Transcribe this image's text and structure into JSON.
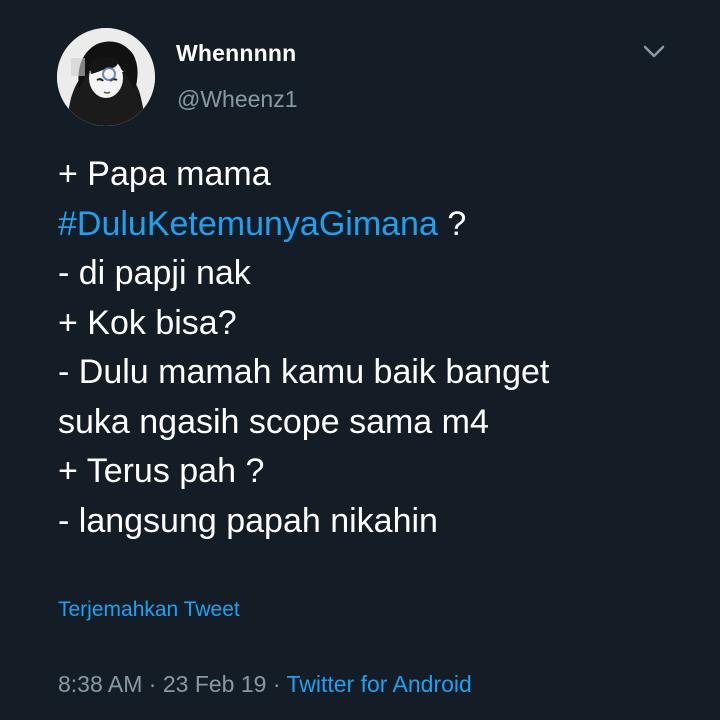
{
  "author": {
    "display_name": "Whennnnn",
    "handle": "@Wheenz1",
    "avatar": "anime-hooded-character-avatar"
  },
  "menu_icon": "chevron-down-icon",
  "tweet": {
    "line1": "+ Papa mama",
    "hashtag": "#DuluKetemunyaGimana",
    "line2_rest": " ?",
    "line3": "- di papji nak",
    "line4": "+ Kok bisa?",
    "line5": "- Dulu mamah kamu baik banget",
    "line6": "suka ngasih scope sama m4",
    "line7": "+ Terus pah ?",
    "line8": "- langsung papah nikahin"
  },
  "translate_label": "Terjemahkan Tweet",
  "meta": {
    "time": "8:38 AM",
    "separator": " · ",
    "date": "23 Feb 19",
    "source": "Twitter for Android"
  },
  "colors": {
    "background": "#141d26",
    "text": "#ffffff",
    "muted": "#8899a6",
    "accent": "#1da1f2"
  }
}
